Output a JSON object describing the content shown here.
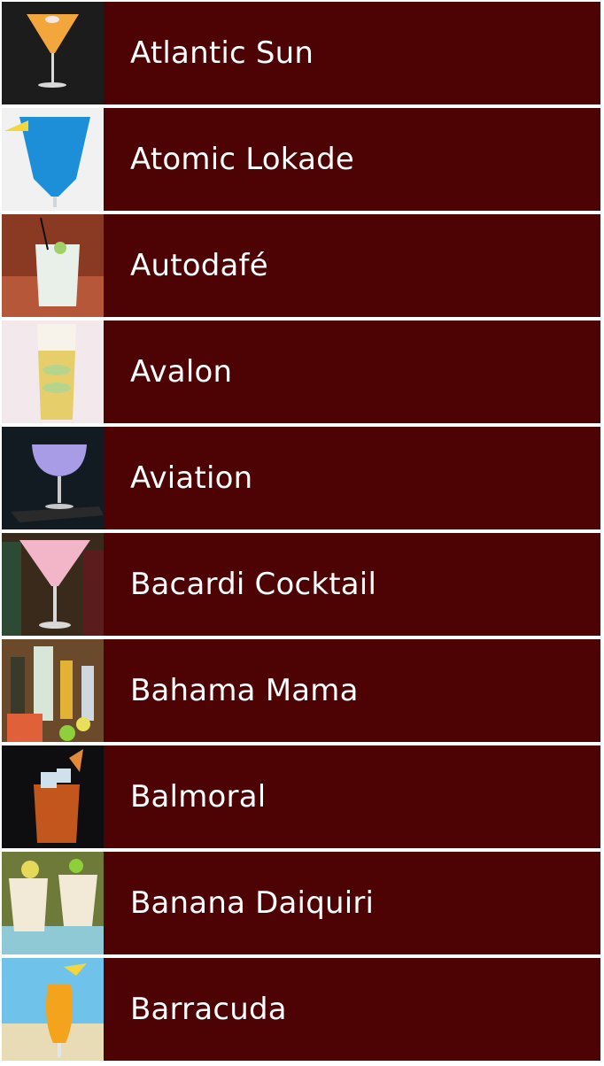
{
  "cocktails": [
    {
      "name": "Atlantic Sun",
      "thumb_icon": "orange-martini-glass-icon",
      "bg": "#1c1c1c",
      "drink": "#f2a63c"
    },
    {
      "name": "Atomic Lokade",
      "thumb_icon": "blue-hurricane-glass-icon",
      "bg": "#f1f1f1",
      "drink": "#1c8fd8"
    },
    {
      "name": "Autodafé",
      "thumb_icon": "clear-rocks-glass-icon",
      "bg": "#8a3a22",
      "drink": "#e9f0ea"
    },
    {
      "name": "Avalon",
      "thumb_icon": "yellow-highball-glass-icon",
      "bg": "#f3e9ec",
      "drink": "#e6cf6a"
    },
    {
      "name": "Aviation",
      "thumb_icon": "purple-coupe-glass-icon",
      "bg": "#121b22",
      "drink": "#a89ce6"
    },
    {
      "name": "Bacardi Cocktail",
      "thumb_icon": "pink-martini-glass-icon",
      "bg": "#3a2a1c",
      "drink": "#f2b6c8"
    },
    {
      "name": "Bahama Mama",
      "thumb_icon": "bottles-and-mugs-icon",
      "bg": "#6a4a2a",
      "drink": "#e0603a"
    },
    {
      "name": "Balmoral",
      "thumb_icon": "amber-rocks-glass-icon",
      "bg": "#0e0e10",
      "drink": "#c2561c"
    },
    {
      "name": "Banana Daiquiri",
      "thumb_icon": "creamy-daiquiri-glasses-icon",
      "bg": "#6e7a3a",
      "drink": "#f2ead6"
    },
    {
      "name": "Barracuda",
      "thumb_icon": "tropical-orange-glass-icon",
      "bg": "#6fc3ea",
      "drink": "#f4a41c"
    }
  ]
}
